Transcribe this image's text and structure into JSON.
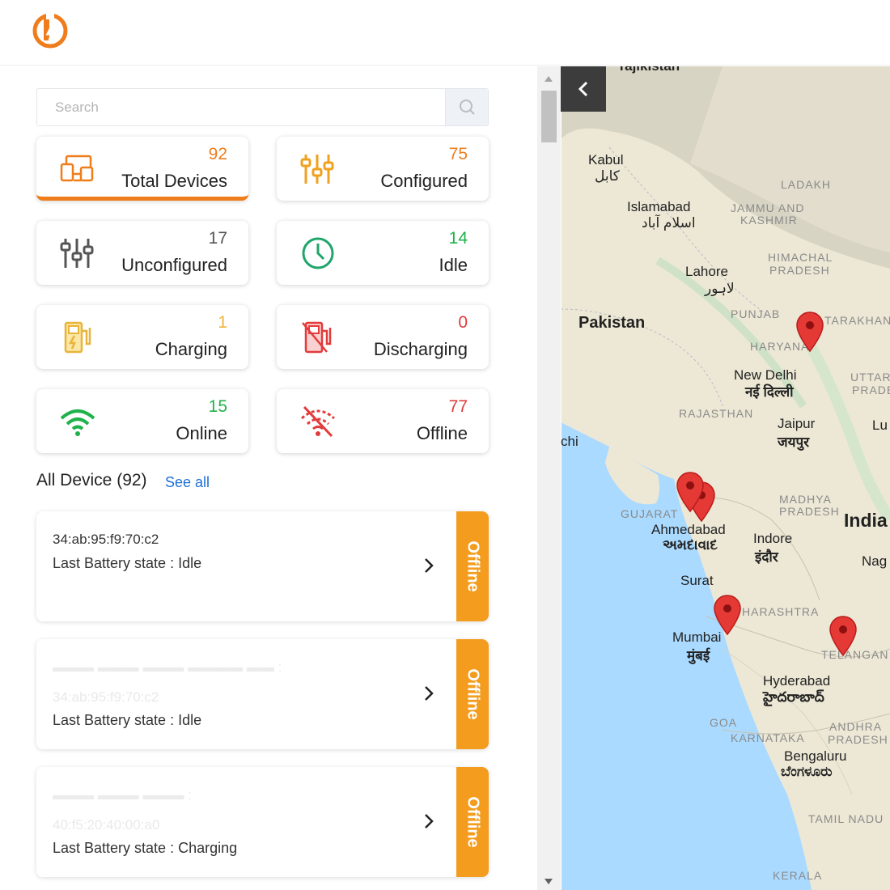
{
  "search": {
    "placeholder": "Search"
  },
  "stats": [
    {
      "count": "92",
      "label": "Total Devices",
      "color": "#ef7d1c",
      "icon": "devices-icon"
    },
    {
      "count": "75",
      "label": "Configured",
      "color": "#ef7d1c",
      "icon": "sliders-icon"
    },
    {
      "count": "17",
      "label": "Unconfigured",
      "color": "#555555",
      "icon": "sliders-icon"
    },
    {
      "count": "14",
      "label": "Idle",
      "color": "#1fb24a",
      "icon": "clock-icon"
    },
    {
      "count": "1",
      "label": "Charging",
      "color": "#f0b43a",
      "icon": "charging-station-icon"
    },
    {
      "count": "0",
      "label": "Discharging",
      "color": "#e23b3b",
      "icon": "discharging-station-icon"
    },
    {
      "count": "15",
      "label": "Online",
      "color": "#1fb24a",
      "icon": "wifi-icon"
    },
    {
      "count": "77",
      "label": "Offline",
      "color": "#e23b3b",
      "icon": "wifi-off-icon"
    }
  ],
  "devices_section": {
    "title": "All Device (92)",
    "see_all": "See all"
  },
  "devices": [
    {
      "mac": "34:ab:95:f9:70:c2",
      "state": "Last Battery state : Idle",
      "status": "Offline"
    },
    {
      "mac": "34:ab:95:f9:70:c2",
      "state": "Last Battery state : Idle",
      "status": "Offline"
    },
    {
      "mac": "40:f5:20:40:00:a0",
      "state": "Last Battery state : Charging",
      "status": "Offline"
    }
  ],
  "map": {
    "labels": [
      "Tajikistan",
      "Kabul",
      "کابل",
      "Islamabad",
      "اسلام آباد",
      "LADAKH",
      "JAMMU AND",
      "KASHMIR",
      "Lahore",
      "لاہور",
      "HIMACHAL",
      "PRADESH",
      "Pakistan",
      "PUNJAB",
      "TARAKHAN",
      "HARYANA",
      "New Delhi",
      "नई दिल्ली",
      "UTTAR",
      "PRADES",
      "RAJASTHAN",
      "Jaipur",
      "जयपुर",
      "Lu",
      "chi",
      "GUJARAT",
      "Ahmedabad",
      "અમદાવાદ",
      "MADHYA",
      "PRADESH",
      "India",
      "Indore",
      "इंदौर",
      "Nag",
      "Surat",
      "HARASHTRA",
      "Mumbai",
      "मुंबई",
      "TELANGAN",
      "Hyderabad",
      "హైదరాబాద్",
      "GOA",
      "ANDHRA",
      "KARNATAKA",
      "PRADESH",
      "Bengaluru",
      "ಬೆಂಗಳೂರು",
      "TAMIL NADU",
      "KERALA"
    ]
  }
}
